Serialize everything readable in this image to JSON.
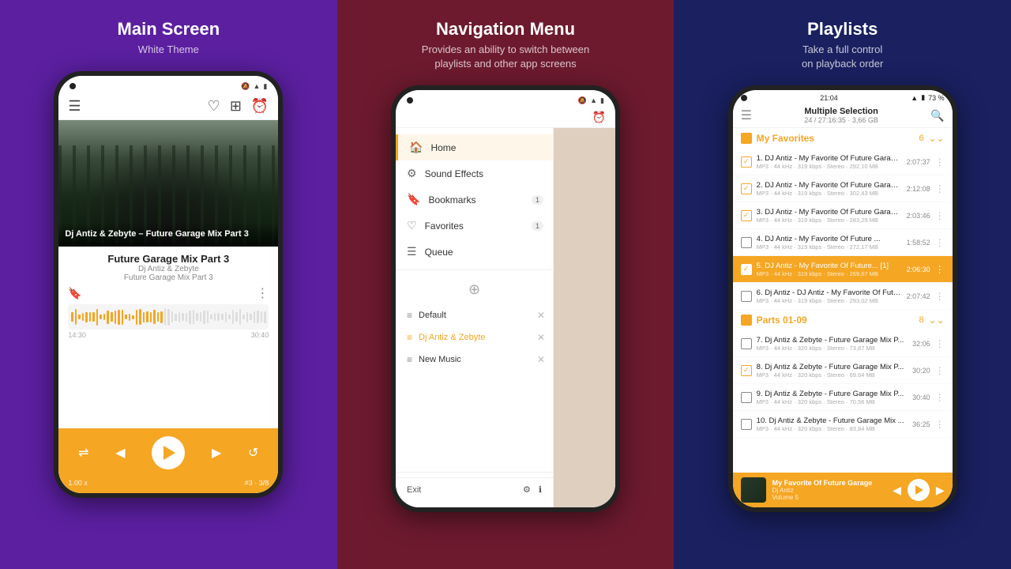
{
  "panels": [
    {
      "id": "main-screen",
      "title": "Main Screen",
      "subtitle": "White Theme"
    },
    {
      "id": "navigation-menu",
      "title": "Navigation Menu",
      "subtitle": "Provides an ability to switch between\nplaylists and other app screens"
    },
    {
      "id": "playlists",
      "title": "Playlists",
      "subtitle": "Take a full control\non playback order"
    }
  ],
  "screen1": {
    "topbar": {
      "menu_icon": "☰",
      "heart_icon": "♡",
      "equalizer_icon": "⊞",
      "alarm_icon": "⏰"
    },
    "track": {
      "title": "Future Garage Mix Part 3",
      "artist": "Dj Antiz & Zebyte",
      "album": "Future Garage Mix Part 3",
      "overlay_title": "Dj Antiz & Zebyte –\nFuture Garage Mix\nPart 3"
    },
    "time": {
      "current": "14:30",
      "total": "30:40"
    },
    "meta": {
      "speed": "1.00 x",
      "track_num": "#3 · 3/8"
    }
  },
  "screen2": {
    "nav_items": [
      {
        "label": "Home",
        "icon": "🏠",
        "active": true,
        "badge": null
      },
      {
        "label": "Sound Effects",
        "icon": "⚙",
        "active": false,
        "badge": null
      },
      {
        "label": "Bookmarks",
        "icon": "🔖",
        "active": false,
        "badge": "1"
      },
      {
        "label": "Favorites",
        "icon": "♡",
        "active": false,
        "badge": "1"
      },
      {
        "label": "Queue",
        "icon": "☰",
        "active": false,
        "badge": null
      }
    ],
    "playlists": [
      {
        "label": "Default",
        "active": false
      },
      {
        "label": "Dj Antiz & Zebyte",
        "active": true
      },
      {
        "label": "New Music",
        "active": false
      }
    ],
    "footer": {
      "exit": "Exit",
      "settings_icon": "⚙",
      "info_icon": "ℹ"
    }
  },
  "screen3": {
    "status": {
      "time": "21:04",
      "battery": "73 %"
    },
    "header": {
      "title": "Multiple Selection",
      "subtitle": "24 / 27:16:35 · 3,66 GB"
    },
    "sections": [
      {
        "name": "My Favorites",
        "count": 6,
        "tracks": [
          {
            "num": 1,
            "title": "1. DJ Antiz - My Favorite Of Future Garage ...",
            "meta": "MP3 · 44 kHz · 319 kbps · Stereo · 292,10 MB",
            "duration": "2:07:37",
            "checked": true
          },
          {
            "num": 2,
            "title": "2. DJ Antiz - My Favorite Of Future Garage ...",
            "meta": "MP3 · 44 kHz · 319 kbps · Stereo · 302,43 MB",
            "duration": "2:12:08",
            "checked": true
          },
          {
            "num": 3,
            "title": "3. DJ Antiz - My Favorite Of Future Garage ...",
            "meta": "MP3 · 44 kHz · 319 kbps · Stereo · 283,29 MB",
            "duration": "2:03:46",
            "checked": true
          },
          {
            "num": 4,
            "title": "4. DJ Antiz - My Favorite Of Future ...",
            "meta": "MP3 · 44 kHz · 319 kbps · Stereo · 272,17 MB",
            "duration": "1:58:52",
            "checked": false
          },
          {
            "num": 5,
            "title": "5. DJ Antiz - My Favorite Of Future...  [1]",
            "meta": "MP3 · 44 kHz · 319 kbps · Stereo · 269,67 MB",
            "duration": "2:06:30",
            "checked": true,
            "highlighted": true
          },
          {
            "num": 6,
            "title": "6. Dj Antiz - DJ Antiz - My Favorite Of Futu ...",
            "meta": "MP3 · 44 kHz · 319 kbps · Stereo · 293,02 MB",
            "duration": "2:07:42",
            "checked": false
          }
        ]
      },
      {
        "name": "Parts 01-09",
        "count": 8,
        "tracks": [
          {
            "num": 7,
            "title": "7. Dj Antiz & Zebyte - Future Garage Mix P...",
            "meta": "MP3 · 44 kHz · 320 kbps · Stereo · 73,87 MB",
            "duration": "32:06",
            "checked": false
          },
          {
            "num": 8,
            "title": "8. Dj Antiz & Zebyte - Future Garage Mix P...",
            "meta": "MP3 · 44 kHz · 320 kbps · Stereo · 69,64 MB",
            "duration": "30:20",
            "checked": true
          },
          {
            "num": 9,
            "title": "9. Dj Antiz & Zebyte - Future Garage Mix P...",
            "meta": "MP3 · 44 kHz · 320 kbps · Stereo · 70,56 MB",
            "duration": "30:40",
            "checked": false
          },
          {
            "num": 10,
            "title": "10. Dj Antiz & Zebyte - Future Garage Mix ...",
            "meta": "MP3 · 44 kHz · 320 kbps · Stereo · 83,84 MB",
            "duration": "36:25",
            "checked": false
          }
        ]
      }
    ],
    "footer": {
      "title": "My Favorite Of Future Garage",
      "artist": "Dj Antiz",
      "album": "Volume 5"
    }
  }
}
